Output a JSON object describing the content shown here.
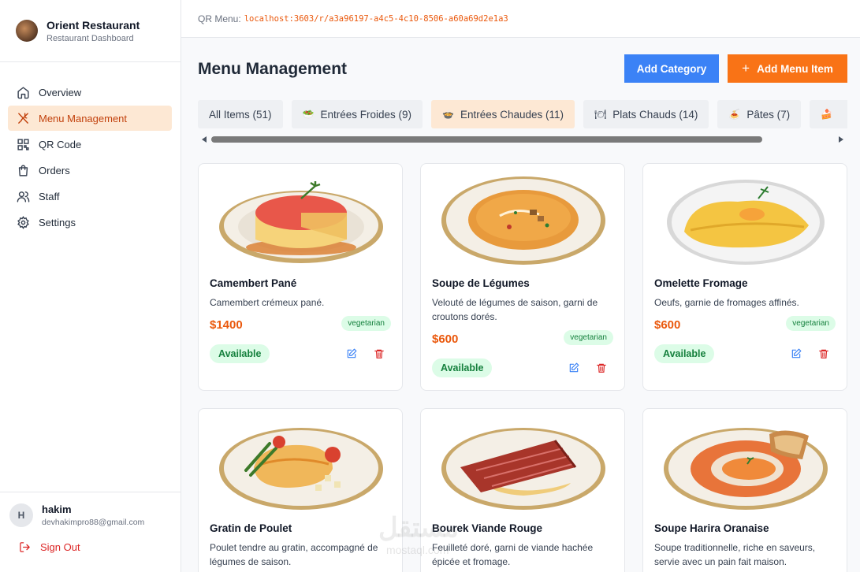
{
  "sidebar": {
    "brand_name": "Orient Restaurant",
    "brand_sub": "Restaurant Dashboard",
    "items": [
      {
        "label": "Overview",
        "icon": "home-icon"
      },
      {
        "label": "Menu Management",
        "icon": "utensils-icon"
      },
      {
        "label": "QR Code",
        "icon": "qr-code-icon"
      },
      {
        "label": "Orders",
        "icon": "shopping-bag-icon"
      },
      {
        "label": "Staff",
        "icon": "users-icon"
      },
      {
        "label": "Settings",
        "icon": "gear-icon"
      }
    ],
    "active_index": 1,
    "user": {
      "initial": "H",
      "name": "hakim",
      "email": "devhakimpro88@gmail.com"
    },
    "sign_out": "Sign Out"
  },
  "topbar": {
    "qr_label": "QR Menu:",
    "qr_url": "localhost:3603/r/a3a96197-a4c5-4c10-8506-a60a69d2e1a3"
  },
  "header": {
    "title": "Menu Management",
    "add_category": "Add Category",
    "add_item": "Add Menu Item",
    "add_item_icon": "plus-icon"
  },
  "tabs": [
    {
      "label": "All Items (51)",
      "icon": ""
    },
    {
      "label": "Entrées Froides (9)",
      "icon": "🥗"
    },
    {
      "label": "Entrées Chaudes (11)",
      "icon": "🍲"
    },
    {
      "label": "Plats Chauds (14)",
      "icon": "🍽"
    },
    {
      "label": "Pâtes (7)",
      "icon": "🍝"
    }
  ],
  "active_tab": 2,
  "cards": [
    {
      "name": "Camembert Pané",
      "desc": "Camembert crémeux pané.",
      "price": "$1400",
      "tag": "vegetarian",
      "status": "Available"
    },
    {
      "name": "Soupe de Légumes",
      "desc": "Velouté de légumes de saison, garni de croutons dorés.",
      "price": "$600",
      "tag": "vegetarian",
      "status": "Available"
    },
    {
      "name": "Omelette Fromage",
      "desc": "Oeufs, garnie de fromages affinés.",
      "price": "$600",
      "tag": "vegetarian",
      "status": "Available"
    },
    {
      "name": "Gratin de Poulet",
      "desc": "Poulet tendre au gratin, accompagné de légumes de saison.",
      "price": "",
      "tag": "",
      "status": ""
    },
    {
      "name": "Bourek Viande Rouge",
      "desc": "Feuilleté doré, garni de viande hachée épicée et fromage.",
      "price": "",
      "tag": "",
      "status": ""
    },
    {
      "name": "Soupe Harira Oranaise",
      "desc": "Soupe traditionnelle, riche en saveurs, servie avec un pain fait maison.",
      "price": "",
      "tag": "",
      "status": ""
    }
  ],
  "watermark": {
    "arabic": "مستقل",
    "latin": "mostaql.com"
  },
  "colors": {
    "accent": "#f97316",
    "blue": "#3b82f6",
    "active_bg": "#fde8d4",
    "available": "#15803d"
  }
}
